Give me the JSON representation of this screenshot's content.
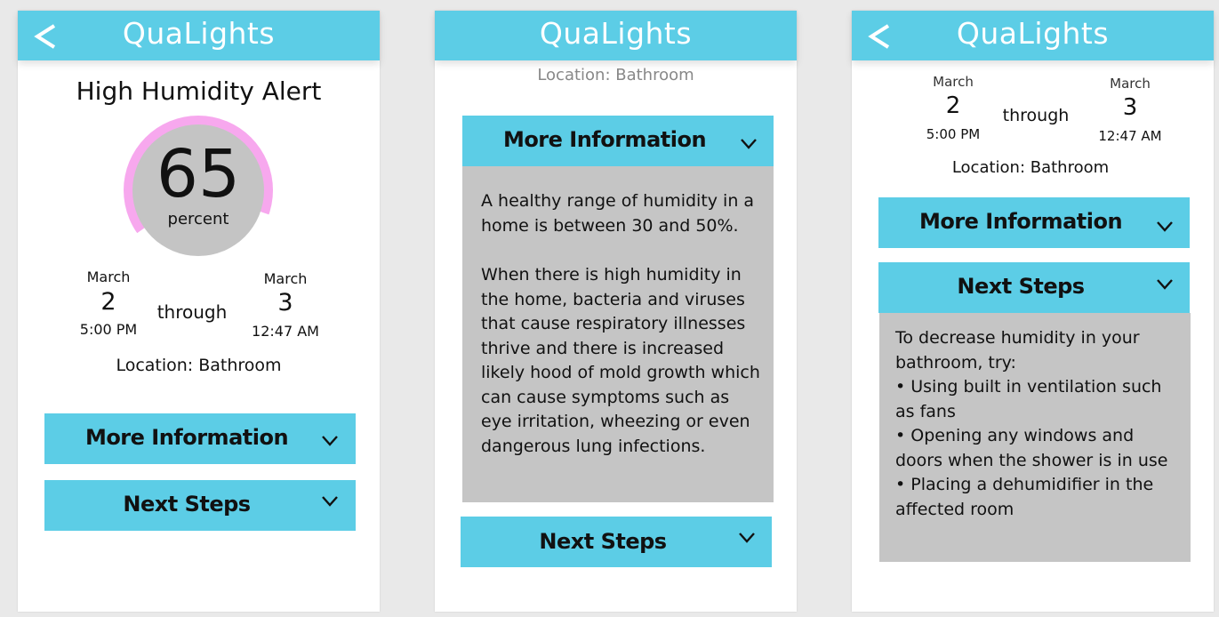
{
  "app": {
    "title": "QuaLights"
  },
  "screen1": {
    "alert_title": "High Humidity Alert",
    "gauge": {
      "value": "65",
      "unit": "percent",
      "fraction": 0.65
    },
    "range": {
      "start": {
        "month": "March",
        "day": "2",
        "time": "5:00 PM"
      },
      "through": "through",
      "end": {
        "month": "March",
        "day": "3",
        "time": "12:47 AM"
      }
    },
    "location": "Location: Bathroom",
    "more_info_label": "More Information",
    "next_steps_label": "Next Steps"
  },
  "screen2": {
    "location": "Location: Bathroom",
    "more_info_label": "More Information",
    "info_paragraphs": [
      "A healthy range of humidity in a home is between 30 and 50%.",
      "When there is high humidity in the home, bacteria and viruses that cause respiratory illnesses thrive and there is increased likely hood of mold growth which can cause symptoms such as eye irritation, wheezing or even dangerous lung infections."
    ],
    "next_steps_label": "Next Steps"
  },
  "screen3": {
    "range": {
      "start": {
        "month": "March",
        "day": "2",
        "time": "5:00 PM"
      },
      "through": "through",
      "end": {
        "month": "March",
        "day": "3",
        "time": "12:47 AM"
      }
    },
    "location": "Location: Bathroom",
    "more_info_label": "More Information",
    "next_steps_label": "Next Steps",
    "steps_intro": "To decrease humidity in your bathroom, try:",
    "steps": [
      "• Using built in ventilation such as fans",
      "• Opening any windows and doors when the shower is in use",
      "• Placing a dehumidifier in the affected room"
    ]
  },
  "colors": {
    "accent": "#5ccde6",
    "gauge_fill": "#f7a8ee",
    "gauge_bg": "#c4c4c4",
    "panel": "#c5c5c5"
  }
}
